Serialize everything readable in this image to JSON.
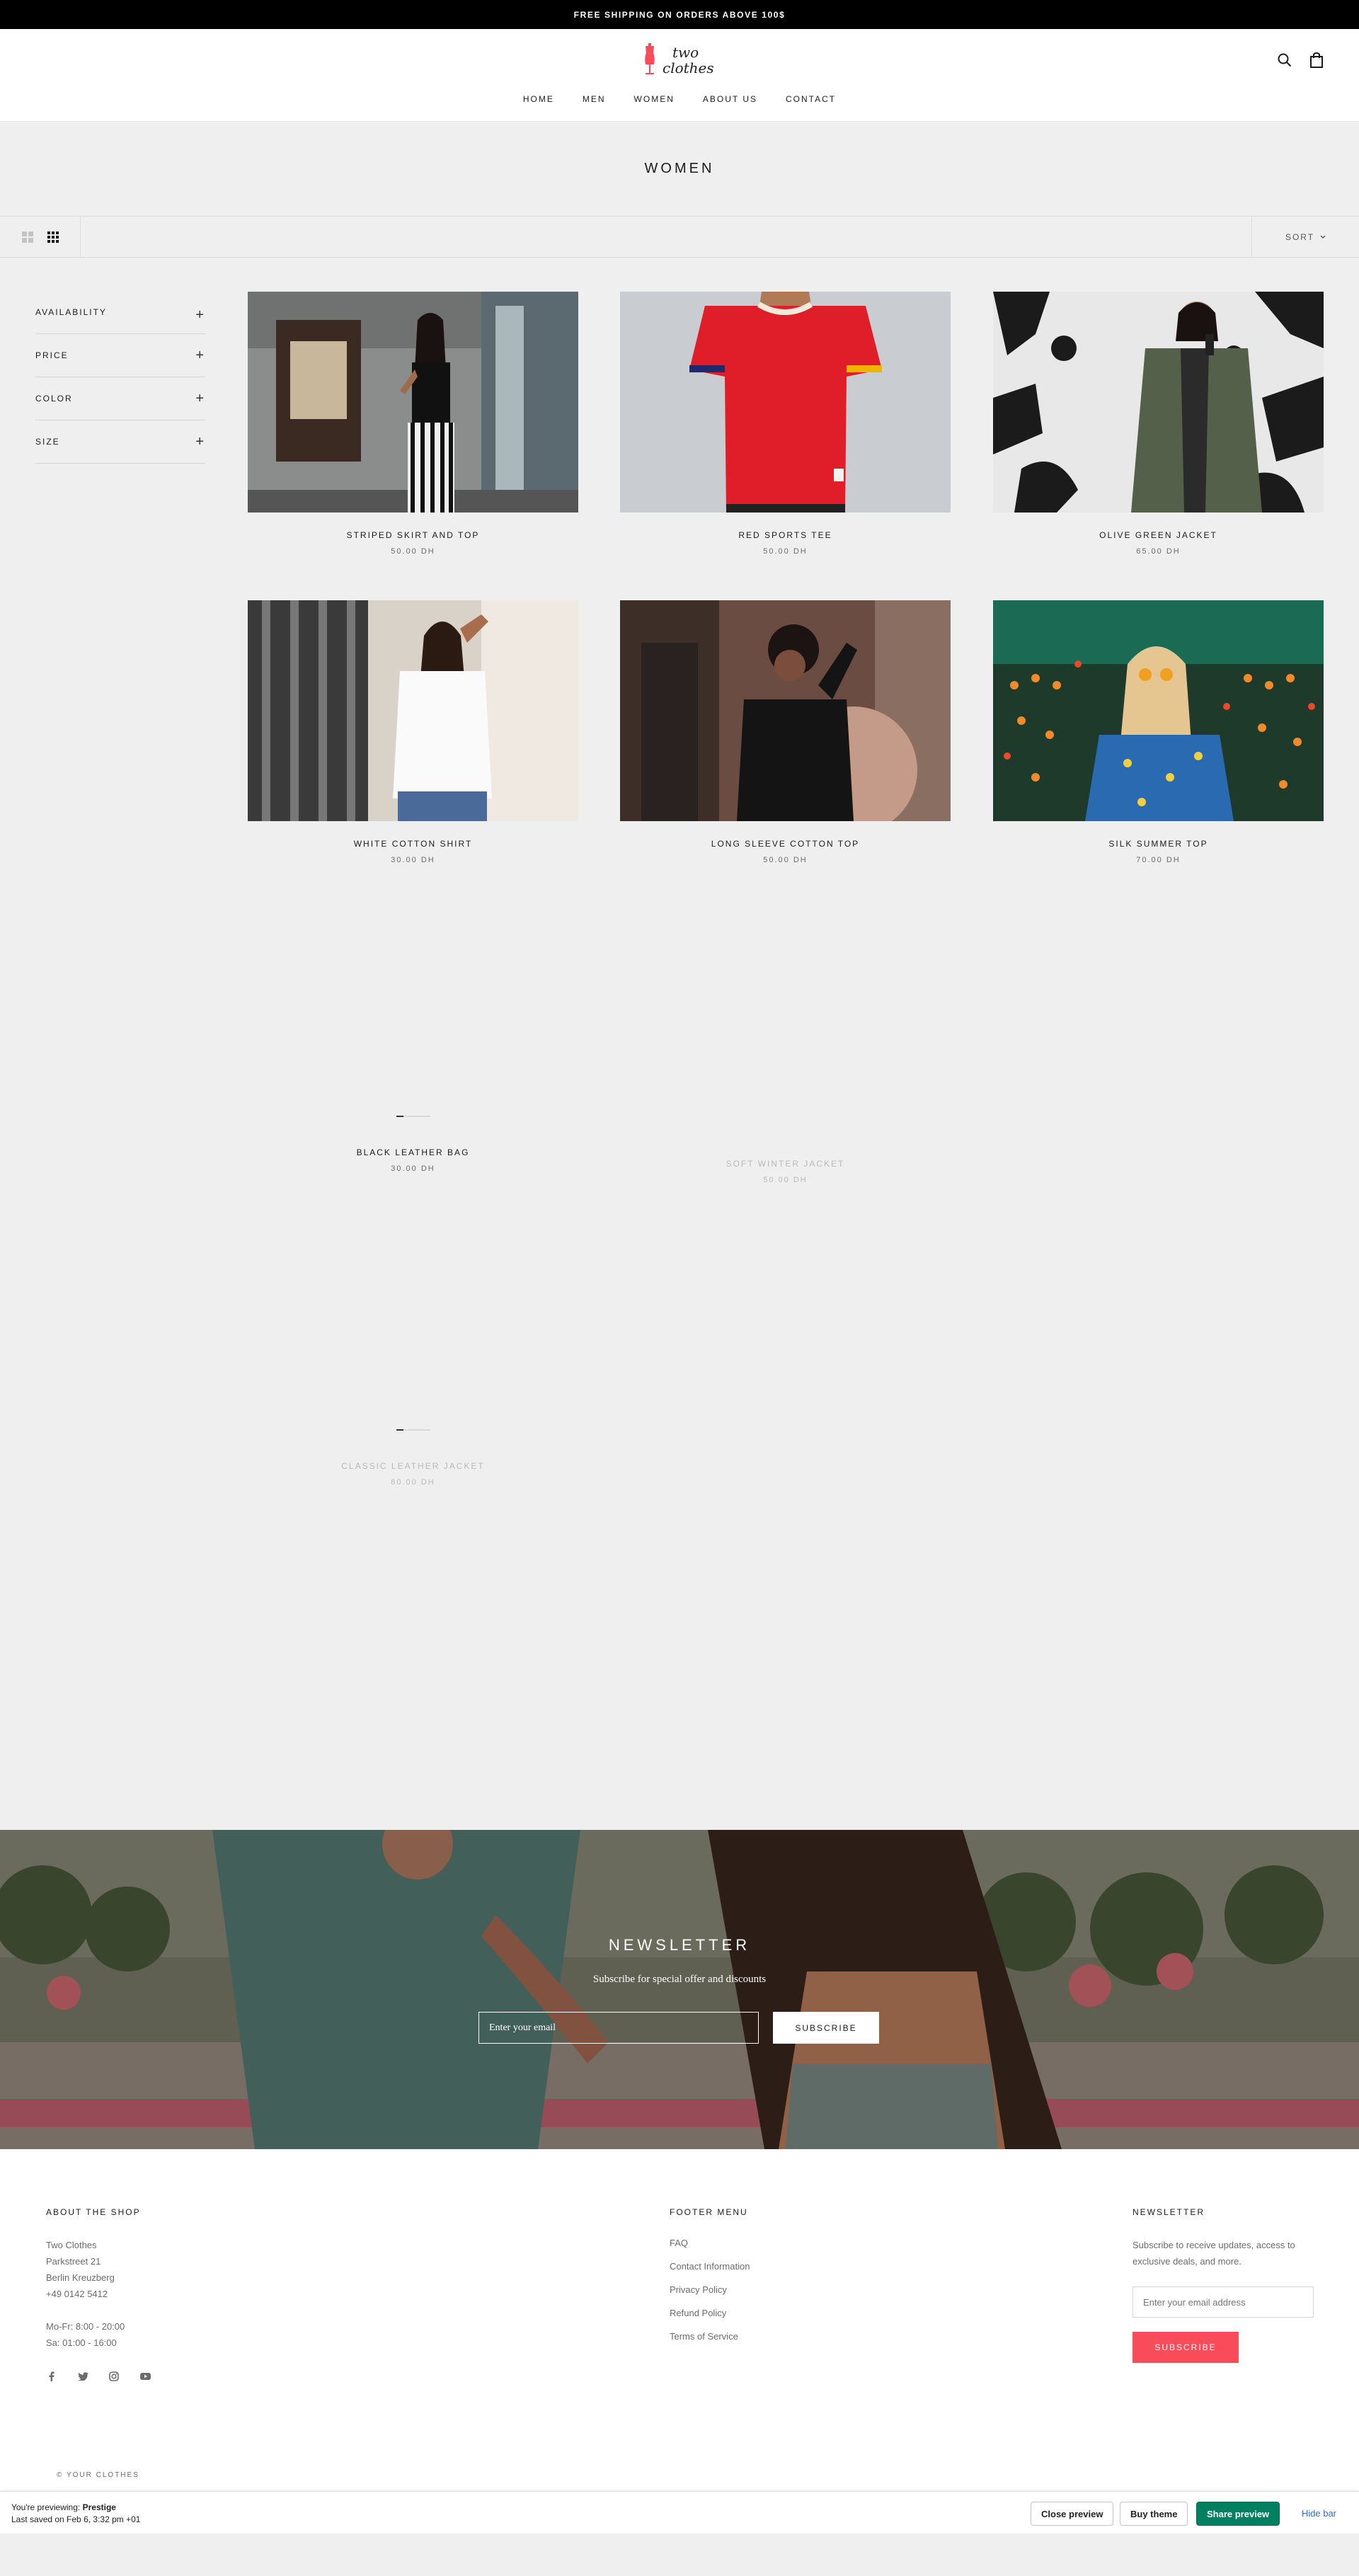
{
  "announcement": "FREE SHIPPING ON ORDERS ABOVE 100$",
  "header": {
    "logo_line1": "two",
    "logo_line2": "clothes",
    "nav": [
      "HOME",
      "MEN",
      "WOMEN",
      "ABOUT US",
      "CONTACT"
    ]
  },
  "collection": {
    "title": "WOMEN",
    "sort_label": "SORT",
    "filters": [
      "AVAILABILITY",
      "PRICE",
      "COLOR",
      "SIZE"
    ]
  },
  "products": [
    {
      "name": "STRIPED SKIRT AND TOP",
      "price": "50.00 DH"
    },
    {
      "name": "RED SPORTS TEE",
      "price": "50.00 DH"
    },
    {
      "name": "OLIVE GREEN JACKET",
      "price": "65.00 DH"
    },
    {
      "name": "WHITE COTTON SHIRT",
      "price": "30.00 DH"
    },
    {
      "name": "LONG SLEEVE COTTON TOP",
      "price": "50.00 DH"
    },
    {
      "name": "SILK SUMMER TOP",
      "price": "70.00 DH"
    },
    {
      "name": "BLACK LEATHER BAG",
      "price": "30.00 DH"
    },
    {
      "name": "SOFT WINTER JACKET",
      "price": "50.00 DH"
    },
    {
      "name": "CLASSIC LEATHER JACKET",
      "price": "80.00 DH"
    }
  ],
  "newsletter": {
    "title": "NEWSLETTER",
    "subtitle": "Subscribe for special offer and discounts",
    "placeholder": "Enter your email",
    "button": "SUBSCRIBE"
  },
  "footer": {
    "about_title": "ABOUT THE SHOP",
    "address": [
      "Two Clothes",
      "Parkstreet 21",
      "Berlin Kreuzberg",
      "+49 0142 5412"
    ],
    "hours": [
      "Mo-Fr: 8:00 - 20:00",
      "Sa: 01:00 - 16:00"
    ],
    "menu_title": "FOOTER MENU",
    "menu": [
      "FAQ",
      "Contact Information",
      "Privacy Policy",
      "Refund Policy",
      "Terms of Service"
    ],
    "newsletter_title": "NEWSLETTER",
    "newsletter_text_1": "Subscribe to receive updates, access to",
    "newsletter_text_2": "exclusive deals, and more.",
    "email_placeholder": "Enter your email address",
    "subscribe": "SUBSCRIBE",
    "copyright": "© YOUR CLOTHES"
  },
  "preview_bar": {
    "previewing_label": "You're previewing:",
    "theme": "Prestige",
    "saved": "Last saved on Feb 6, 3:32 pm +01",
    "close": "Close preview",
    "buy": "Buy theme",
    "share": "Share preview",
    "hide": "Hide bar"
  },
  "colors": {
    "accent": "#f94c5b",
    "background": "#efefef",
    "share_button": "#008060"
  }
}
